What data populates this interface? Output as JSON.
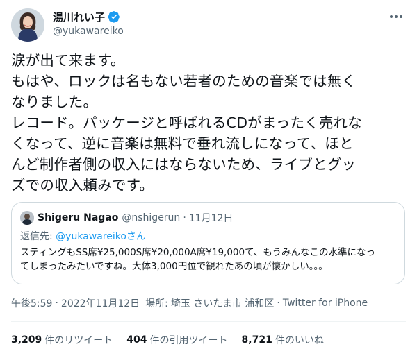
{
  "author": {
    "display_name": "湯川れい子",
    "handle": "@yukawareiko",
    "verified_icon": "verified-badge-icon",
    "accent": "#1d9bf0"
  },
  "tweet": {
    "lines": [
      "涙が出て来ます。",
      "もはや、ロックは名もない若者のための音楽では無く",
      "なりました。",
      "レコード。パッケージと呼ばれるCDがまったく売れな",
      "くなって、逆に音楽は無料で垂れ流しになって、ほと",
      "んど制作者側の収入にはならないため、ライブとグッ",
      "ズでの収入頼みです。"
    ]
  },
  "quote": {
    "name": "Shigeru Nagao",
    "handle": "@nshigerun",
    "separator": "·",
    "date": "11月12日",
    "reply_prefix": "返信先: ",
    "reply_mention": "@yukawareikoさん",
    "lines": [
      "スティングもSS席¥25,000S席¥20,000A席¥19,000て、もうみんなこの水準になっ",
      "てしまったみたいですね。大体3,000円位で観れたあの頃が懐かしい。。。"
    ]
  },
  "meta": {
    "time": "午後5:59",
    "separator": "·",
    "date": "2022年11月12日",
    "place_label": "場所:",
    "place": "埼玉 さいたま市 浦和区",
    "client": "Twitter for iPhone"
  },
  "stats": {
    "retweets": {
      "count": "3,209",
      "label": "件のリツイート"
    },
    "quotes": {
      "count": "404",
      "label": "件の引用ツイート"
    },
    "likes": {
      "count": "8,721",
      "label": "件のいいね"
    }
  }
}
